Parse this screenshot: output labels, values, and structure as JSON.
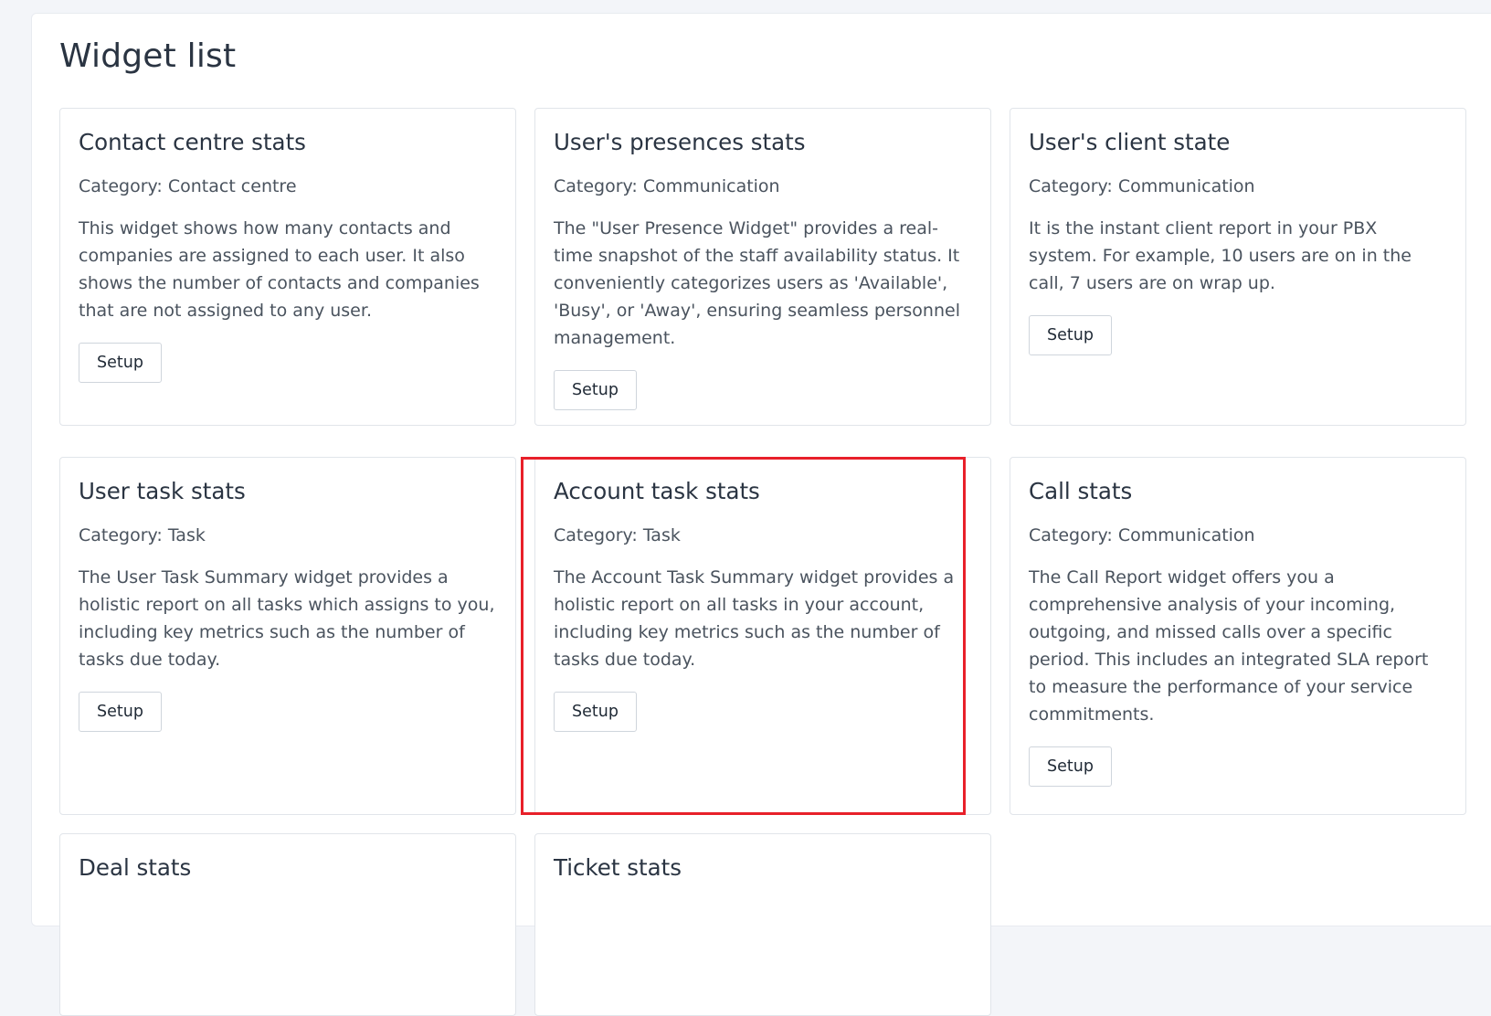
{
  "page": {
    "title": "Widget list",
    "button_label": "Setup"
  },
  "cards": [
    {
      "title": "Contact centre stats",
      "category": "Category: Contact centre",
      "description": "This widget shows how many contacts and companies are assigned to each user. It also shows the number of contacts and companies that are not assigned to any user."
    },
    {
      "title": "User's presences stats",
      "category": "Category: Communication",
      "description": "The \"User Presence Widget\" provides a real-time snapshot of the staff availability status. It conveniently categorizes users as 'Available', 'Busy', or 'Away', ensuring seamless personnel management."
    },
    {
      "title": "User's client state",
      "category": "Category: Communication",
      "description": "It is the instant client report in your PBX system. For example, 10 users are on in the call, 7 users are on wrap up."
    },
    {
      "title": "User task stats",
      "category": "Category: Task",
      "description": "The User Task Summary widget provides a holistic report on all tasks which assigns to you, including key metrics such as the number of tasks due today."
    },
    {
      "title": "Account task stats",
      "category": "Category: Task",
      "description": "The Account Task Summary widget provides a holistic report on all tasks in your account, including key metrics such as the number of tasks due today."
    },
    {
      "title": "Call stats",
      "category": "Category: Communication",
      "description": "The Call Report widget offers you a comprehensive analysis of your incoming, outgoing, and missed calls over a specific period. This includes an integrated SLA report to measure the performance of your service commitments."
    },
    {
      "title": "Deal stats",
      "category": "",
      "description": ""
    },
    {
      "title": "Ticket stats",
      "category": "",
      "description": ""
    }
  ],
  "colors": {
    "highlight": "#e8202a",
    "background": "#f3f5f9",
    "card_border": "#e1e5ea"
  }
}
